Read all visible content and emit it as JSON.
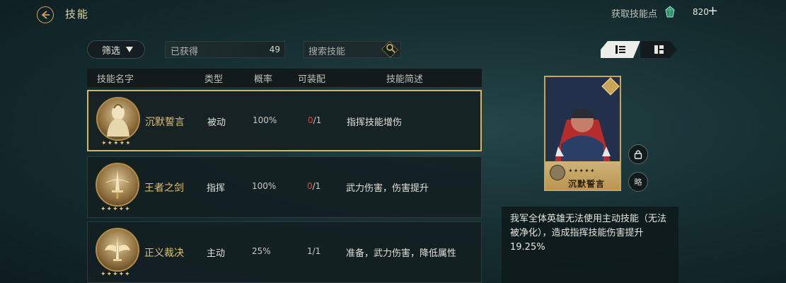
{
  "header": {
    "title": "技能",
    "get_points_label": "获取技能点",
    "points": "820",
    "plus": "+"
  },
  "toolbar": {
    "filter_label": "筛选",
    "obtained_label": "已获得",
    "obtained_count": "49",
    "search_placeholder": "搜索技能"
  },
  "table": {
    "columns": [
      "技能名字",
      "类型",
      "概率",
      "可装配",
      "技能简述"
    ],
    "rows": [
      {
        "name": "沉默誓言",
        "type": "被动",
        "rate": "100%",
        "equip_cur": "0",
        "equip_max": "/1",
        "desc": "指挥技能增伤",
        "stars": "✦✦✦✦✦",
        "selected": true
      },
      {
        "name": "王者之剑",
        "type": "指挥",
        "rate": "100%",
        "equip_cur": "0",
        "equip_max": "/1",
        "desc": "武力伤害，伤害提升",
        "stars": "✦✦✦✦✦",
        "selected": false
      },
      {
        "name": "正义裁决",
        "type": "主动",
        "rate": "25%",
        "equip_cur": "1",
        "equip_max": "/1",
        "desc": "准备，武力伤害，降低属性",
        "stars": "✦✦✦✦✦",
        "selected": false
      }
    ]
  },
  "detail": {
    "card_name": "沉默誓言",
    "card_stars": "✦✦✦✦✦",
    "skip_label": "略",
    "description": "我军全体英雄无法使用主动技能（无法被净化），造成指挥技能伤害提升19.25%"
  },
  "colors": {
    "accent_gold": "#d6b55a",
    "warn_red": "#d94a3c",
    "background": "#173033"
  }
}
